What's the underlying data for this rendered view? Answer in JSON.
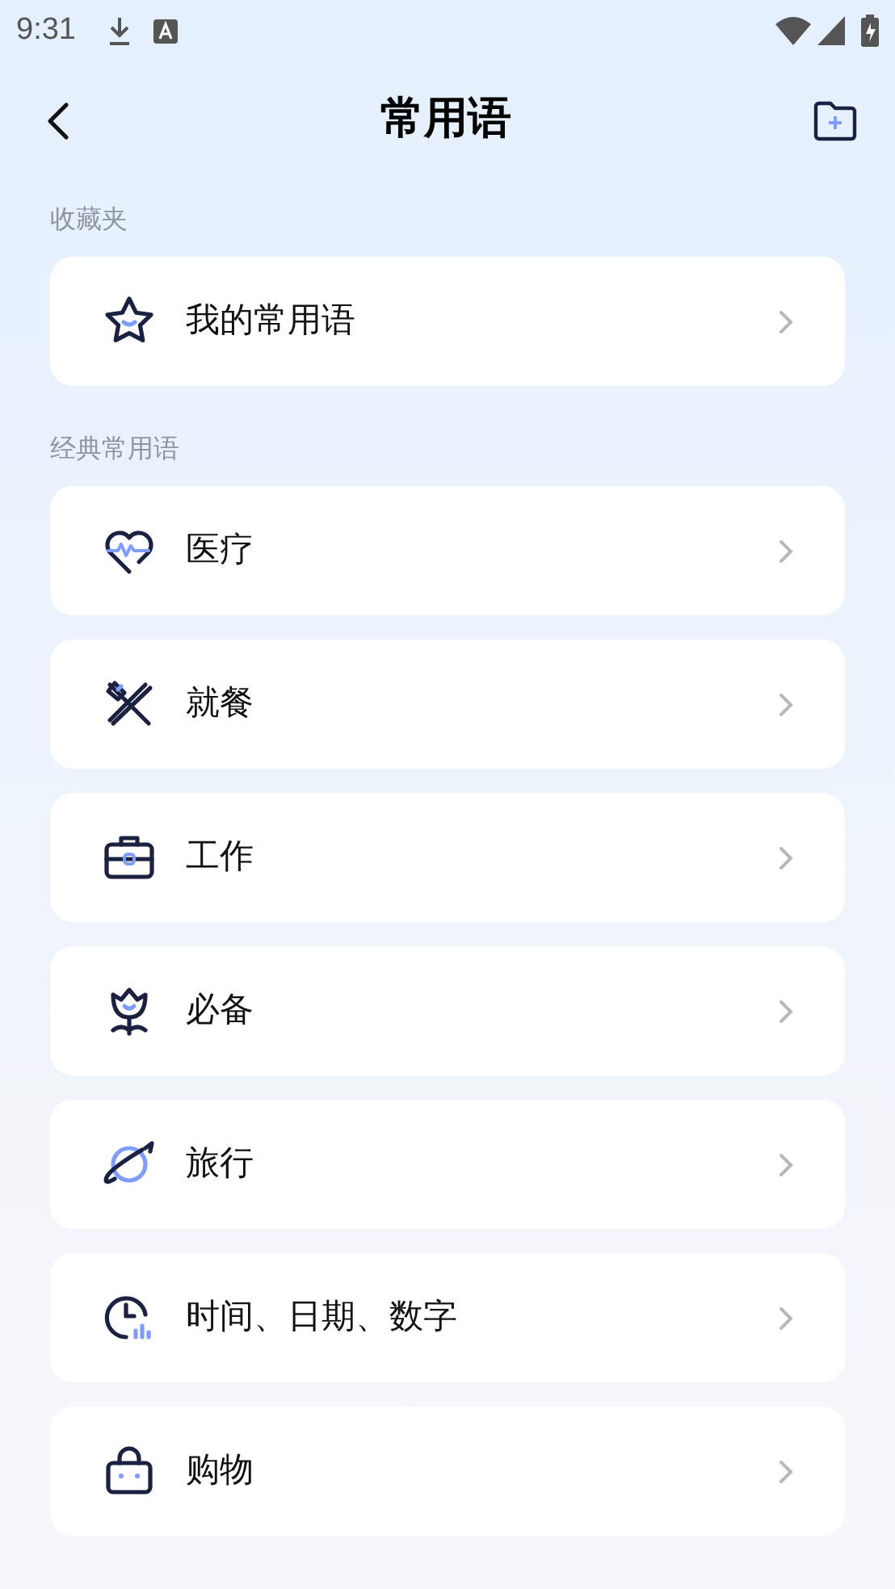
{
  "status_bar": {
    "time": "9:31"
  },
  "header": {
    "title": "常用语"
  },
  "sections": [
    {
      "title": "收藏夹",
      "items": [
        {
          "label": "我的常用语",
          "kind": "star"
        }
      ]
    },
    {
      "title": "经典常用语",
      "items": [
        {
          "label": "医疗",
          "kind": "heart"
        },
        {
          "label": "就餐",
          "kind": "utensils"
        },
        {
          "label": "工作",
          "kind": "briefcase"
        },
        {
          "label": "必备",
          "kind": "flower"
        },
        {
          "label": "旅行",
          "kind": "planet"
        },
        {
          "label": "时间、日期、数字",
          "kind": "clock"
        },
        {
          "label": "购物",
          "kind": "bag"
        }
      ]
    }
  ]
}
